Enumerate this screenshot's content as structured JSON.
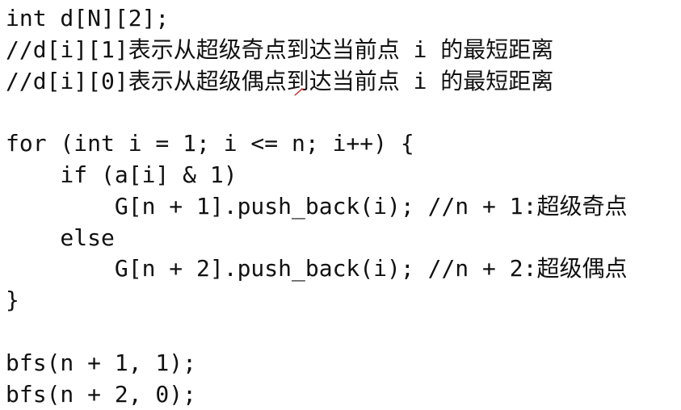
{
  "code_lines": [
    "int d[N][2];",
    "//d[i][1]表示从超级奇点到达当前点 i 的最短距离",
    "//d[i][0]表示从超级偶点到达当前点 i 的最短距离",
    "",
    "for (int i = 1; i <= n; i++) {",
    "    if (a[i] & 1)",
    "        G[n + 1].push_back(i); //n + 1:超级奇点",
    "    else",
    "        G[n + 2].push_back(i); //n + 2:超级偶点",
    "}",
    "",
    "bfs(n + 1, 1);",
    "bfs(n + 2, 0);"
  ],
  "colors": {
    "text": "#111111",
    "background": "#ffffff",
    "pen_cursor": "#cc2222"
  }
}
